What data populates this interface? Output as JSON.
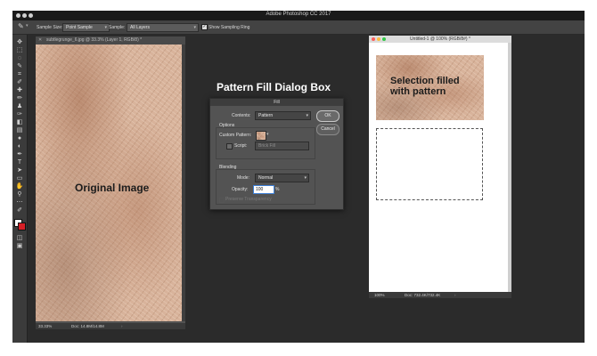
{
  "app": {
    "title": "Adobe Photoshop CC 2017"
  },
  "options_bar": {
    "sample_size_label": "Sample Size:",
    "sample_size_value": "Point Sample",
    "sample_label": "Sample:",
    "sample_value": "All Layers",
    "show_sampling_ring_label": "Show Sampling Ring"
  },
  "doc_left": {
    "tab_title": "subtlegrunge_6.jpg @ 33.3% (Layer 1, RGB/8) *",
    "zoom": "33.33%",
    "doc_size": "Doc: 14.8M/14.8M",
    "overlay_label": "Original Image"
  },
  "doc_right": {
    "title": "Untitled-1 @ 100% (RGB/8#) *",
    "zoom": "100%",
    "doc_size": "Doc: 732.4K/732.4K",
    "overlay_label_line1": "Selection filled",
    "overlay_label_line2": "with pattern"
  },
  "heading": "Pattern Fill Dialog Box",
  "fill_dialog": {
    "title": "Fill",
    "contents_label": "Contents:",
    "contents_value": "Pattern",
    "ok_label": "OK",
    "cancel_label": "Cancel",
    "options_label": "Options",
    "custom_pattern_label": "Custom Pattern:",
    "script_label": "Script:",
    "script_value": "Brick Fill",
    "blending_label": "Blending",
    "mode_label": "Mode:",
    "mode_value": "Normal",
    "opacity_label": "Opacity:",
    "opacity_value": "100",
    "opacity_unit": "%",
    "preserve_transparency_label": "Preserve Transparency"
  }
}
